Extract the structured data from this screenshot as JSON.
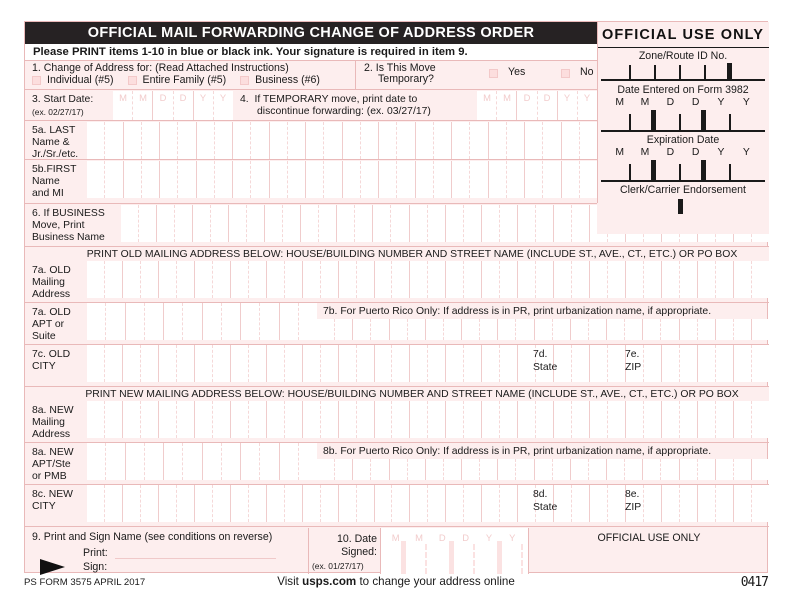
{
  "title": "OFFICIAL MAIL FORWARDING CHANGE OF ADDRESS ORDER",
  "instruction": "Please PRINT items 1-10 in blue or black ink. Your signature is required in item 9.",
  "item1": {
    "label": "1. Change of Address for: (Read Attached Instructions)",
    "options": [
      "Individual (#5)",
      "Entire Family (#5)",
      "Business (#6)"
    ]
  },
  "item2": {
    "label_line1": "2. Is This Move",
    "label_line2": "Temporary?",
    "options": [
      "Yes",
      "No"
    ]
  },
  "item3": {
    "label": "3. Start Date:",
    "example": "(ex. 02/27/17)"
  },
  "item4": {
    "label_line1": "If TEMPORARY move, print date to",
    "label_line2": "discontinue forwarding: (ex. 03/27/17)",
    "number": "4."
  },
  "item5a": {
    "line1": "5a. LAST",
    "line2": "Name &",
    "line3": "Jr./Sr./etc."
  },
  "item5b": {
    "line1": "5b.FIRST",
    "line2": "Name",
    "line3": "and MI"
  },
  "item6": {
    "line1": "6. If BUSINESS",
    "line2": "Move, Print",
    "line3": "Business Name"
  },
  "banner_old": "PRINT OLD MAILING ADDRESS BELOW: HOUSE/BUILDING NUMBER AND STREET NAME (INCLUDE ST., AVE., CT., ETC.) OR PO BOX",
  "banner_new": "PRINT NEW MAILING ADDRESS BELOW: HOUSE/BUILDING NUMBER AND STREET NAME (INCLUDE ST., AVE., CT., ETC.) OR PO BOX",
  "item7a_mail": {
    "line1": "7a. OLD",
    "line2": "Mailing",
    "line3": "Address"
  },
  "item7a_apt": {
    "line1": "7a. OLD",
    "line2": "APT or",
    "line3": "Suite"
  },
  "item7b": "7b. For Puerto Rico Only: If address is in PR, print urbanization name, if appropriate.",
  "item7c": {
    "line1": "7c. OLD",
    "line2": "CITY"
  },
  "item7d": {
    "line1": "7d.",
    "line2": "State"
  },
  "item7e": {
    "line1": "7e.",
    "line2": "ZIP"
  },
  "item8a_mail": {
    "line1": "8a. NEW",
    "line2": "Mailing",
    "line3": "Address"
  },
  "item8a_apt": {
    "line1": "8a. NEW",
    "line2": "APT/Ste",
    "line3": "or PMB"
  },
  "item8b": "8b. For Puerto Rico Only: If address is in PR, print urbanization name, if appropriate.",
  "item8c": {
    "line1": "8c. NEW",
    "line2": "CITY"
  },
  "item8d": {
    "line1": "8d.",
    "line2": "State"
  },
  "item8e": {
    "line1": "8e.",
    "line2": "ZIP"
  },
  "item9": {
    "label": "9. Print and Sign Name (see conditions on reverse)",
    "print_label": "Print:",
    "sign_label": "Sign:"
  },
  "item10": {
    "label_line1": "10. Date",
    "label_line2": "Signed:",
    "example": "(ex. 01/27/17)"
  },
  "official_use_bottom": "OFFICIAL USE ONLY",
  "official_use": {
    "heading": "OFFICIAL USE ONLY",
    "zone_route": "Zone/Route ID No.",
    "date_entered": "Date Entered on Form 3982",
    "expiration": "Expiration Date",
    "endorsement": "Clerk/Carrier Endorsement",
    "mdy": [
      "M",
      "M",
      "D",
      "D",
      "Y",
      "Y"
    ]
  },
  "mdy_small": [
    "M",
    "M",
    "D",
    "D",
    "Y",
    "Y"
  ],
  "footer": {
    "form_id": "PS FORM 3575  APRIL 2017",
    "visit_pre": "Visit ",
    "visit_site": "usps.com",
    "visit_post": " to change your address online",
    "code": "0417"
  },
  "colors": {
    "paper": "#fdeeee",
    "rule": "#e9b9b9",
    "cell_rule": "#f0cccc",
    "checkbox": "#fcdede",
    "ink": "#1a1a1a",
    "titlebar": "#262223"
  }
}
